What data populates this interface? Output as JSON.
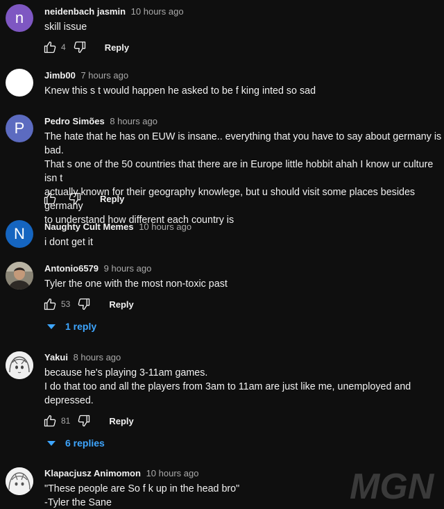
{
  "comments": [
    {
      "author": "neidenbach jasmin",
      "time": "10 hours ago",
      "text": "skill issue",
      "likes": "4",
      "reply_label": "Reply",
      "avatar": {
        "letter": "n",
        "color": "#7e57c2"
      }
    },
    {
      "author": "Jimb00",
      "time": "7 hours ago",
      "text": "Knew this s   t would happen he asked to be f   king inted so sad",
      "avatar": {
        "letter": "",
        "color": "#ffffff"
      }
    },
    {
      "author": "Pedro Simões",
      "time": "8 hours ago",
      "text": "The hate that he has on EUW is insane.. everything that you have to say about germany is bad.\nThat s one of the 50 countries that there are in Europe little hobbit ahah I know ur culture isn t\nactually known for their geography knowlege, but u should visit some places besides germany\nto understand how different each country is",
      "likes": "",
      "reply_label": "Reply",
      "avatar": {
        "letter": "P",
        "color": "#5c6bc0"
      }
    },
    {
      "author": "Naughty Cult Memes",
      "time": "10 hours ago",
      "text": "i dont get it",
      "avatar": {
        "letter": "N",
        "color": "#1565c0"
      }
    },
    {
      "author": "Antonio6579",
      "time": "9 hours ago",
      "text": "Tyler the one with the most non-toxic past",
      "likes": "53",
      "reply_label": "Reply",
      "replies_label": "1 reply",
      "avatar": {
        "letter": "",
        "color": "#6d6a5a",
        "icon": "photo-avatar"
      }
    },
    {
      "author": "Yakui",
      "time": "8 hours ago",
      "text": "because he's playing 3-11am games.\nI do that too and all the players from 3am to 11am are just like me, unemployed and\ndepressed.",
      "likes": "81",
      "reply_label": "Reply",
      "replies_label": "6 replies",
      "avatar": {
        "letter": "",
        "color": "#e8e8e8",
        "icon": "anime-avatar"
      }
    },
    {
      "author": "Klapacjusz Animomon",
      "time": "10 hours ago",
      "text": "\"These people are So f   k up in the head bro\"\n-Tyler the Sane",
      "avatar": {
        "letter": "",
        "color": "#ececec",
        "icon": "anime-avatar"
      }
    }
  ],
  "icons": {
    "like": "thumbs-up-icon",
    "dislike": "thumbs-down-icon",
    "expand": "caret-down-icon"
  },
  "colors": {
    "background": "#0f0f0f",
    "text": "#f1f1f1",
    "meta": "#aaaaaa",
    "link": "#3ea6ff"
  },
  "watermark": {
    "text": "MGN",
    "color": "#3a3a3a"
  }
}
